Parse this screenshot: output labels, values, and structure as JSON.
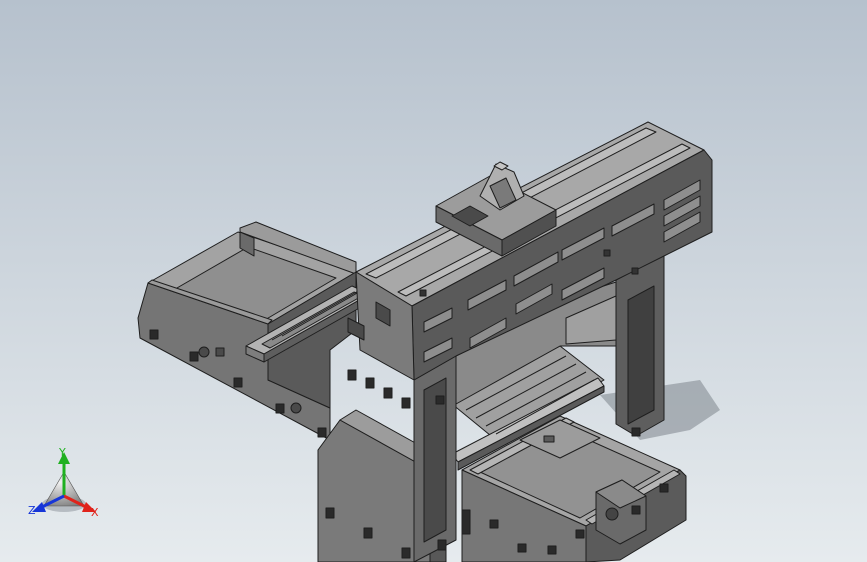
{
  "viewport": {
    "background_top": "#b6c1cd",
    "background_bottom": "#e6ebee"
  },
  "colors": {
    "face_top": "#a7a7a7",
    "face_left": "#6f6f6f",
    "face_right": "#8a8a8a",
    "face_dark": "#4e4e4e",
    "edge": "#1e1e1e",
    "shadow": "#7e858c",
    "axis_x": "#e0231b",
    "axis_y": "#1fb020",
    "axis_z": "#1736d8"
  },
  "triad": {
    "x_label": "X",
    "y_label": "Y",
    "z_label": "Z"
  },
  "icons": {
    "model": "machine-tool-model",
    "triad": "view-orientation-triad"
  }
}
